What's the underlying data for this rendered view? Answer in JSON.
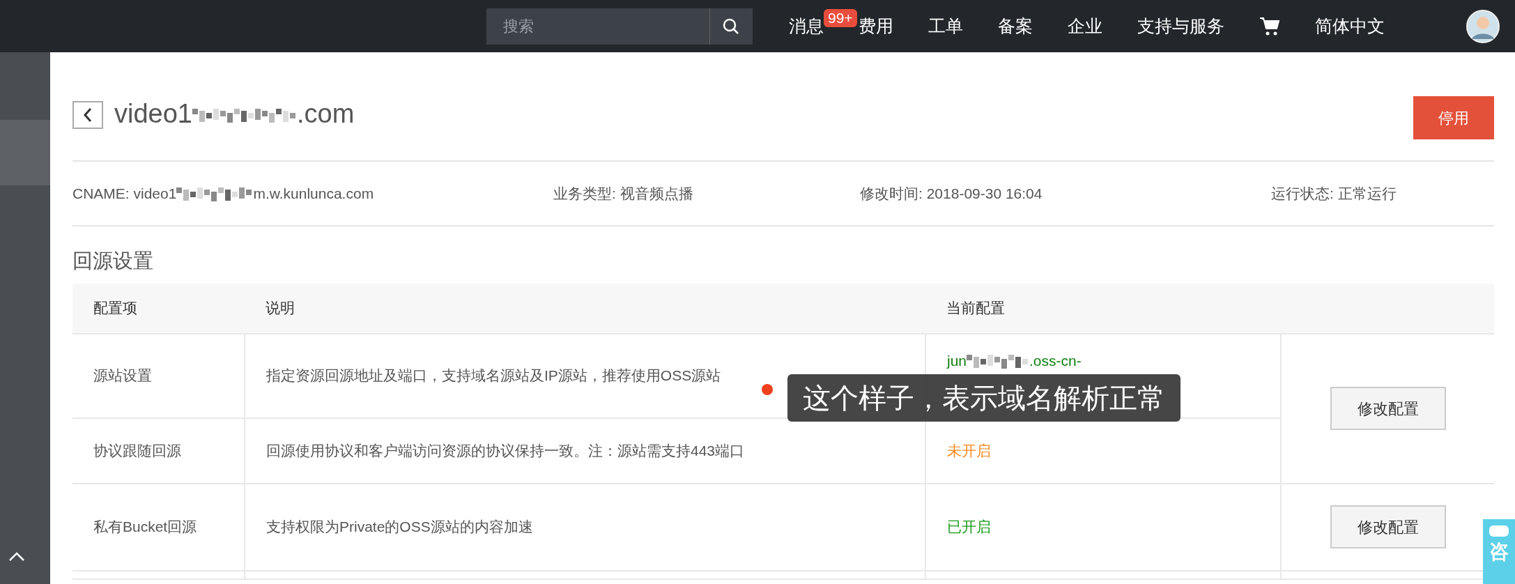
{
  "top_bar": {
    "search": {
      "placeholder": "搜索"
    },
    "nav": [
      {
        "kind": "text",
        "label": "消息",
        "badge": "99+"
      },
      {
        "kind": "text",
        "label": "费用"
      },
      {
        "kind": "text",
        "label": "工单"
      },
      {
        "kind": "text",
        "label": "备案"
      },
      {
        "kind": "text",
        "label": "企业"
      },
      {
        "kind": "text",
        "label": "支持与服务"
      },
      {
        "kind": "cart"
      },
      {
        "kind": "text",
        "label": "简体中文"
      }
    ]
  },
  "header": {
    "title_parts": [
      "video1",
      ".com"
    ],
    "button": "停用"
  },
  "info": [
    {
      "parts": [
        "CNAME: video1",
        "m.w.kunlunca.com"
      ]
    },
    {
      "parts": [
        "业务类型: 视音频点播"
      ]
    },
    {
      "parts": [
        "修改时间: 2018-09-30 16:04"
      ]
    },
    {
      "parts": [
        "运行状态: 正常运行"
      ]
    }
  ],
  "section": {
    "title": "回源设置",
    "table": {
      "columns": [
        "配置项",
        "说明",
        "当前配置"
      ],
      "rows": [
        {
          "name": "源站设置",
          "desc": "指定资源回源地址及端口，支持域名源站及IP源站，推荐使用OSS源站",
          "config": {
            "kind": "value",
            "parts": [
              "jun",
              ".oss-cn-"
            ]
          },
          "action": "修改配置"
        },
        {
          "name": "协议跟随回源",
          "desc": "回源使用协议和客户端访问资源的协议保持一致。注：源站需支持443端口",
          "config": {
            "kind": "off",
            "text": "未开启"
          }
        },
        {
          "name": "私有Bucket回源",
          "desc": "支持权限为Private的OSS源站的内容加速",
          "config": {
            "kind": "on",
            "text": "已开启"
          },
          "action": "修改配置"
        }
      ]
    }
  },
  "tooltip": {
    "text": "这个样子，表示域名解析正常"
  },
  "consult": {
    "label": "咨"
  }
}
